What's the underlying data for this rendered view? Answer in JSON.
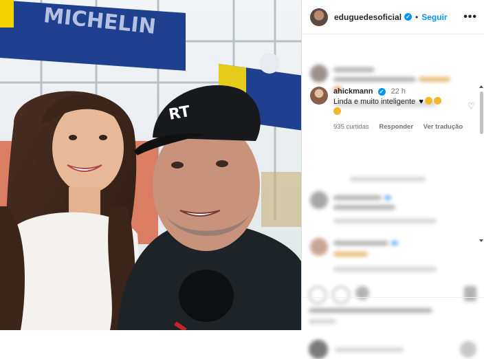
{
  "header": {
    "username": "eduguedesoficial",
    "separator": "•",
    "follow_label": "Seguir",
    "more_label": "•••"
  },
  "comment": {
    "username": "ahickmann",
    "time": "22 h",
    "text": "Linda e muito inteligente",
    "likes": "935 curtidas",
    "reply_label": "Responder",
    "translate_label": "Ver tradução",
    "heart_icon": "♡"
  },
  "colors": {
    "accent": "#0095f6",
    "text": "#262626",
    "muted": "#737373"
  }
}
